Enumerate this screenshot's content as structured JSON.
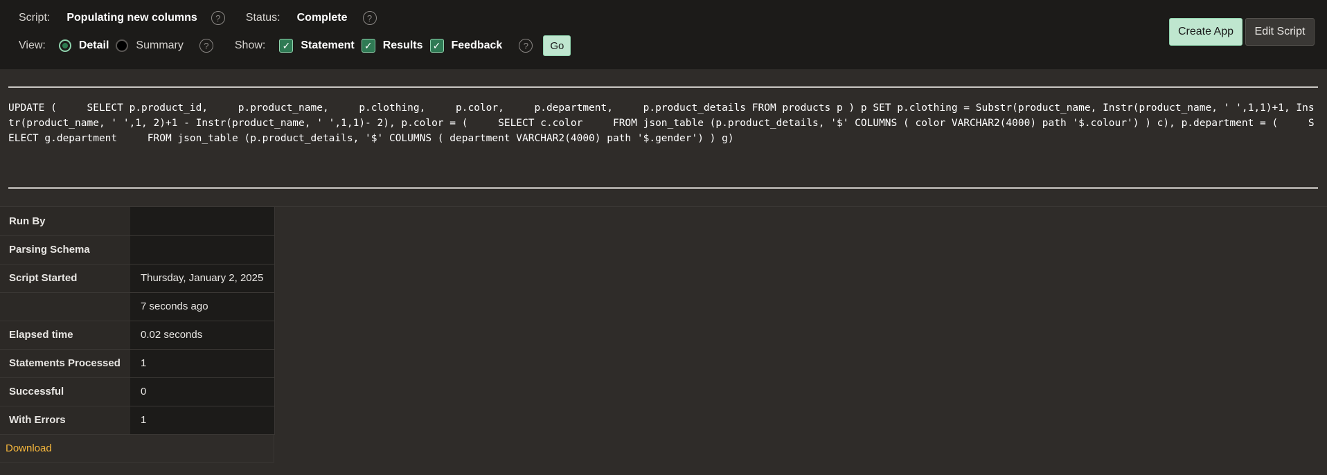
{
  "header": {
    "script_label": "Script:",
    "script_name": "Populating new columns",
    "status_label": "Status:",
    "status_value": "Complete",
    "view_label": "View:",
    "view_options": [
      "Detail",
      "Summary"
    ],
    "view_selected": "Detail",
    "show_label": "Show:",
    "show_options": [
      "Statement",
      "Results",
      "Feedback"
    ],
    "go_label": "Go",
    "help_glyph": "?",
    "check_glyph": "✓"
  },
  "actions": {
    "create_app": "Create App",
    "edit_script": "Edit Script"
  },
  "statement": "UPDATE (     SELECT p.product_id,     p.product_name,     p.clothing,     p.color,     p.department,     p.product_details FROM products p ) p SET p.clothing = Substr(product_name, Instr(product_name, ' ',1,1)+1, Instr(product_name, ' ',1, 2)+1 - Instr(product_name, ' ',1,1)- 2), p.color = (     SELECT c.color     FROM json_table (p.product_details, '$' COLUMNS ( color VARCHAR2(4000) path '$.colour') ) c), p.department = (     SELECT g.department     FROM json_table (p.product_details, '$' COLUMNS ( department VARCHAR2(4000) path '$.gender') ) g)",
  "details": [
    {
      "label": "Run By",
      "value": ""
    },
    {
      "label": "Parsing Schema",
      "value": ""
    },
    {
      "label": "Script Started",
      "value": "Thursday, January 2, 2025"
    },
    {
      "label": "",
      "value": "7 seconds ago"
    },
    {
      "label": "Elapsed time",
      "value": "0.02 seconds"
    },
    {
      "label": "Statements Processed",
      "value": "1"
    },
    {
      "label": "Successful",
      "value": "0"
    },
    {
      "label": "With Errors",
      "value": "1"
    }
  ],
  "download_label": "Download",
  "colors": {
    "accent_green": "#bfe6cf",
    "link_orange": "#f6b73c",
    "background": "#2f2c29",
    "topbar": "#1c1b19"
  }
}
